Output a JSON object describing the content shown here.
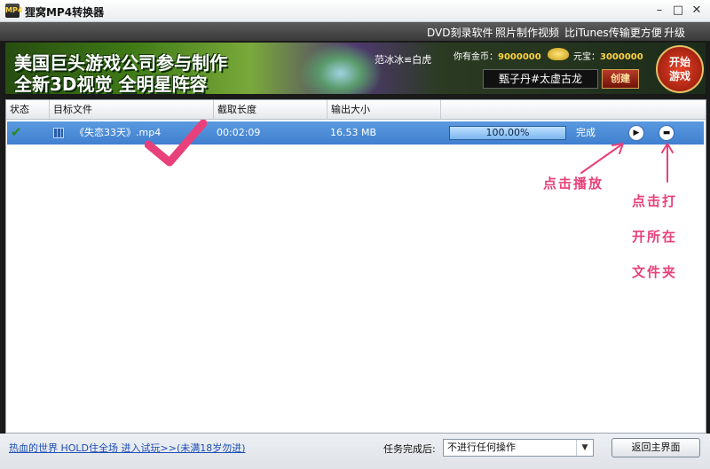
{
  "window": {
    "app_icon_text": "MP4",
    "title": "狸窝MP4转换器",
    "minimize": "–",
    "maximize": "□",
    "close": "✕"
  },
  "menu": {
    "items": [
      "DVD刻录软件",
      "照片制作视频",
      "比iTunes传输更方便",
      "升级"
    ]
  },
  "banner": {
    "line1": "美国巨头游戏公司参与制作",
    "line2": "全新3D视觉 全明星阵容",
    "tag": "范冰冰≌白虎",
    "coins_label": "你有金币：",
    "coins_value": "9000000",
    "treasure_label": "元宝：",
    "treasure_value": "3000000",
    "player_name": "甄子丹#太虚古龙",
    "create_label": "创建",
    "start_label": "开始游戏"
  },
  "list": {
    "columns": [
      "状态",
      "目标文件",
      "截取长度",
      "输出大小",
      ""
    ],
    "rows": [
      {
        "status_icon": "check-icon",
        "file": "《失恋33天》.mp4",
        "duration": "00:02:09",
        "size": "16.53 MB",
        "progress_text": "100.00%",
        "progress": 1.0,
        "state": "完成",
        "play_glyph": "▶",
        "folder_glyph": "▬"
      }
    ]
  },
  "annotations": {
    "play_note": "点击播放",
    "folder_note_lines": [
      "点击打",
      "开所在",
      "文件夹"
    ],
    "accent": "#e8407a"
  },
  "bottom": {
    "promo_link": "热血的世界 HOLD住全场 进入试玩>>(未满18岁勿进)",
    "after_label": "任务完成后:",
    "after_value": "不进行任何操作",
    "home_button": "返回主界面"
  }
}
